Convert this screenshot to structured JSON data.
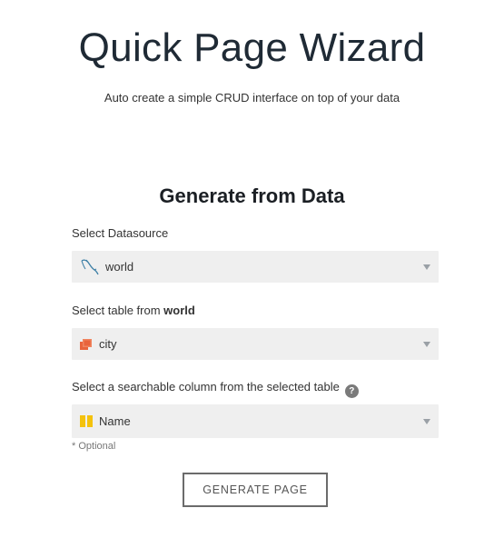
{
  "header": {
    "title": "Quick Page Wizard",
    "subtitle": "Auto create a simple CRUD interface on top of your data"
  },
  "form": {
    "section_title": "Generate from Data",
    "datasource": {
      "label": "Select Datasource",
      "value": "world",
      "icon": "mysql-dolphin-icon"
    },
    "table": {
      "label_prefix": "Select table from ",
      "label_bold": "world",
      "value": "city",
      "icon": "table-icon"
    },
    "column": {
      "label": "Select a searchable column from the selected table",
      "help": "?",
      "value": "Name",
      "icon": "column-icon"
    },
    "optional_note": "* Optional",
    "generate_label": "GENERATE PAGE"
  },
  "colors": {
    "table_icon": "#e8643c",
    "column_icon": "#f4c20d",
    "dolphin_icon": "#3d7fa6",
    "select_bg": "#efefef"
  }
}
